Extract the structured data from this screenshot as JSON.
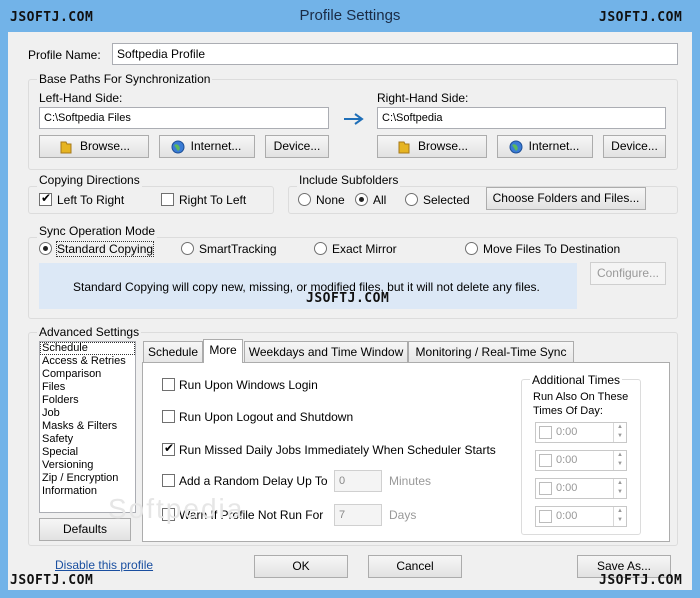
{
  "window": {
    "title": "Profile Settings"
  },
  "watermarks": {
    "text": "JSOFTJ.COM"
  },
  "profile": {
    "label": "Profile Name:",
    "value": "Softpedia Profile"
  },
  "base_paths": {
    "group_label": "Base Paths For Synchronization",
    "left_label": "Left-Hand Side:",
    "left_value": "C:\\Softpedia Files",
    "right_label": "Right-Hand Side:",
    "right_value": "C:\\Softpedia",
    "browse": "Browse...",
    "internet": "Internet...",
    "device": "Device..."
  },
  "copying": {
    "group_label": "Copying Directions",
    "left_to_right": "Left To Right",
    "right_to_left": "Right To Left",
    "left_to_right_checked": true,
    "right_to_left_checked": false
  },
  "subfolders": {
    "group_label": "Include Subfolders",
    "none": "None",
    "all": "All",
    "selected": "Selected",
    "choose_button": "Choose Folders and Files...",
    "value": "All"
  },
  "sync_mode": {
    "group_label": "Sync Operation Mode",
    "options": [
      "Standard Copying",
      "SmartTracking",
      "Exact Mirror",
      "Move Files To Destination"
    ],
    "selected": "Standard Copying",
    "configure": "Configure...",
    "description": "Standard Copying will copy new, missing, or modified files, but it will not delete any files."
  },
  "advanced": {
    "group_label": "Advanced Settings",
    "list": [
      "Schedule",
      "Access & Retries",
      "Comparison",
      "Files",
      "Folders",
      "Job",
      "Masks & Filters",
      "Safety",
      "Special",
      "Versioning",
      "Zip / Encryption",
      "Information"
    ],
    "selected_item": "Schedule",
    "defaults": "Defaults",
    "tabs": [
      "Schedule",
      "More",
      "Weekdays and Time Window",
      "Monitoring / Real-Time Sync"
    ],
    "active_tab": "More",
    "options": {
      "login": "Run Upon Windows Login",
      "logout": "Run Upon Logout and Shutdown",
      "missed": "Run Missed Daily Jobs Immediately When Scheduler Starts",
      "random_delay": "Add a Random Delay Up To",
      "random_delay_value": "0",
      "random_delay_unit": "Minutes",
      "warn": "Warn If Profile Not Run For",
      "warn_value": "7",
      "warn_unit": "Days",
      "missed_checked": true
    },
    "additional_times": {
      "label": "Additional Times",
      "sublabel": "Run Also On These Times Of Day:",
      "times": [
        "0:00",
        "0:00",
        "0:00",
        "0:00"
      ]
    }
  },
  "footer": {
    "disable_link": "Disable this profile",
    "ok": "OK",
    "cancel": "Cancel",
    "save_as": "Save As..."
  },
  "background_watermark": "Softpedia",
  "colors": {
    "titlebar": "#72b3e8",
    "client": "#f0f0f0",
    "note_bg": "#dce8f6",
    "arrow": "#1f6fb8",
    "link": "#1a4fa0"
  }
}
